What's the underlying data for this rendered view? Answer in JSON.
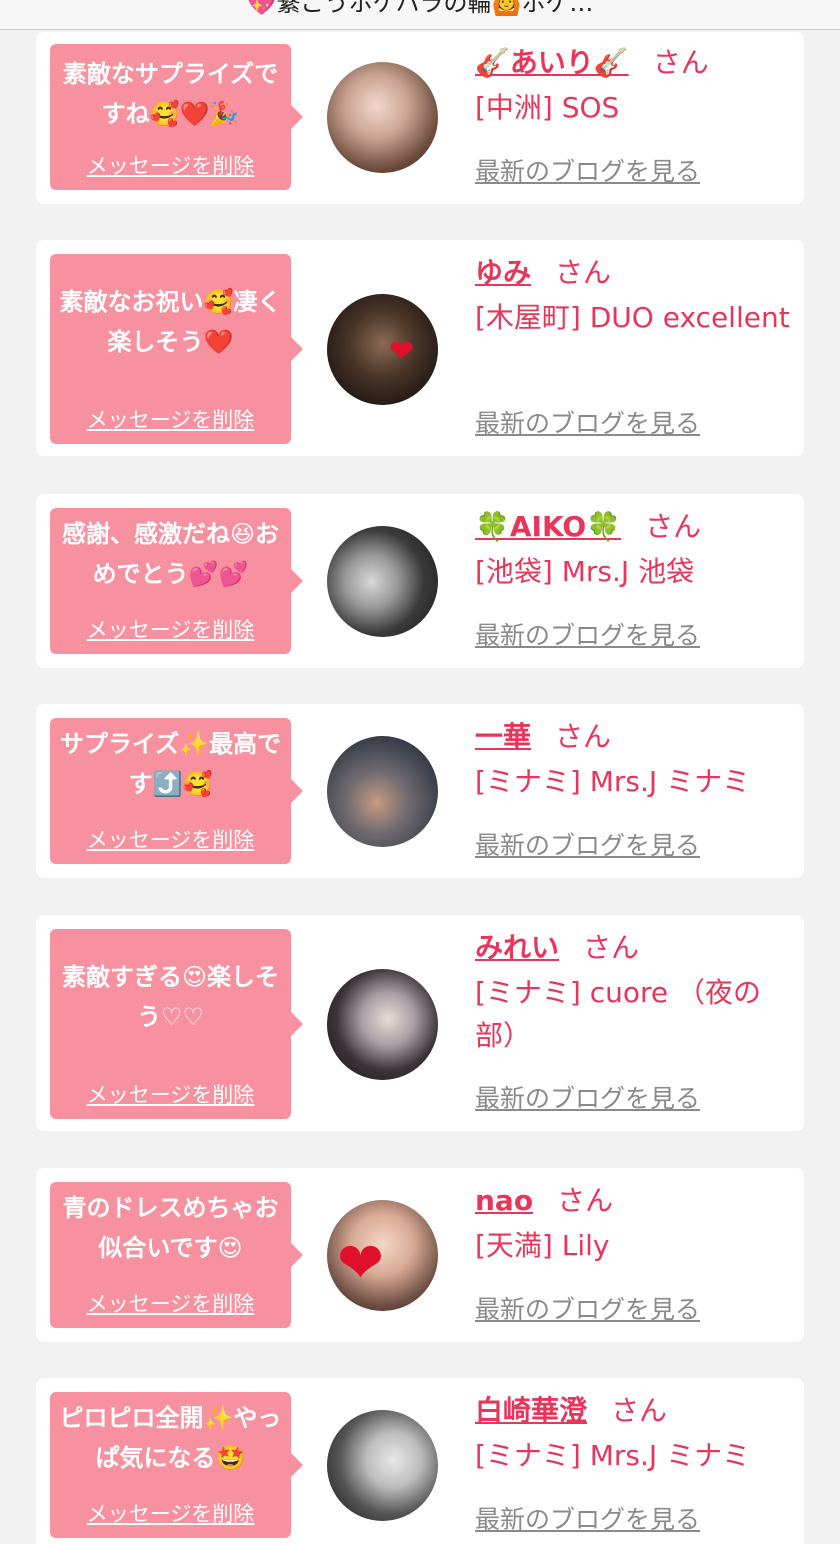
{
  "header": {
    "title": "💖繋ごうホケハラの輪🙆ホケ…"
  },
  "colors": {
    "accent": "#e8365b",
    "bubble": "#f7909f",
    "link_gray": "#8a8a8a"
  },
  "common": {
    "san": "さん",
    "delete_label": "メッセージを削除",
    "blog_label": "最新のブログを見る"
  },
  "messages": [
    {
      "message": "素敵なサプライズですね🥰❤️🎉",
      "name": "🎸あいり🎸",
      "shop": "[中洲] SOS"
    },
    {
      "message": "素敵なお祝い🥰凄く楽しそう❤️",
      "name": "ゆみ",
      "shop": "[木屋町] DUO excellent"
    },
    {
      "message": "感謝、感激だね😆おめでとう💕💕",
      "name": "🍀AIKO🍀",
      "shop": "[池袋] Mrs.J 池袋"
    },
    {
      "message": "サプライズ✨最高です⤴️🥰",
      "name": "一華",
      "shop": "[ミナミ] Mrs.J ミナミ"
    },
    {
      "message": "素敵すぎる😍楽しそう♡♡",
      "name": "みれい",
      "shop": "[ミナミ] cuore （夜の部）"
    },
    {
      "message": "青のドレスめちゃお似合いです😍",
      "name": "nao",
      "shop": "[天満] Lily"
    },
    {
      "message": "ピロピロ全開✨やっぱ気になる🤩",
      "name": "白崎華澄",
      "shop": "[ミナミ] Mrs.J ミナミ"
    }
  ]
}
